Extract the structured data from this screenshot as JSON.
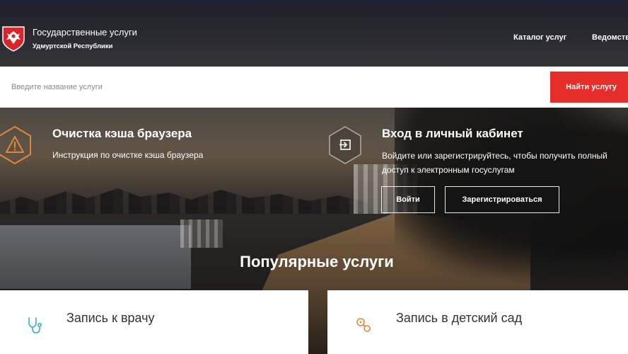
{
  "header": {
    "brand_title": "Государственные услуги",
    "brand_subtitle": "Удмуртской Республики",
    "nav": [
      {
        "label": "Каталог услуг"
      },
      {
        "label": "Ведомства"
      }
    ]
  },
  "search": {
    "placeholder": "Введите название услуги",
    "button_label": "Найти услугу"
  },
  "cache_info": {
    "title": "Очистка кэша браузера",
    "description": "Инструкция по очистке кэша браузера",
    "icon": "warning-icon"
  },
  "cabinet": {
    "title": "Вход в личный кабинет",
    "description": "Войдите или зарегистрируйтесь, чтобы получить полный доступ к электронным госуслугам",
    "login_label": "Войти",
    "register_label": "Зарегистрироваться",
    "icon": "login-icon"
  },
  "popular": {
    "title": "Популярные услуги",
    "items": [
      {
        "label": "Запись к врачу",
        "icon": "stethoscope-icon"
      },
      {
        "label": "Запись в детский сад",
        "icon": "rattle-icon"
      }
    ]
  },
  "colors": {
    "accent_red": "#e52d2a",
    "icon_orange": "#e0883a",
    "icon_teal": "#3ab1c1"
  }
}
